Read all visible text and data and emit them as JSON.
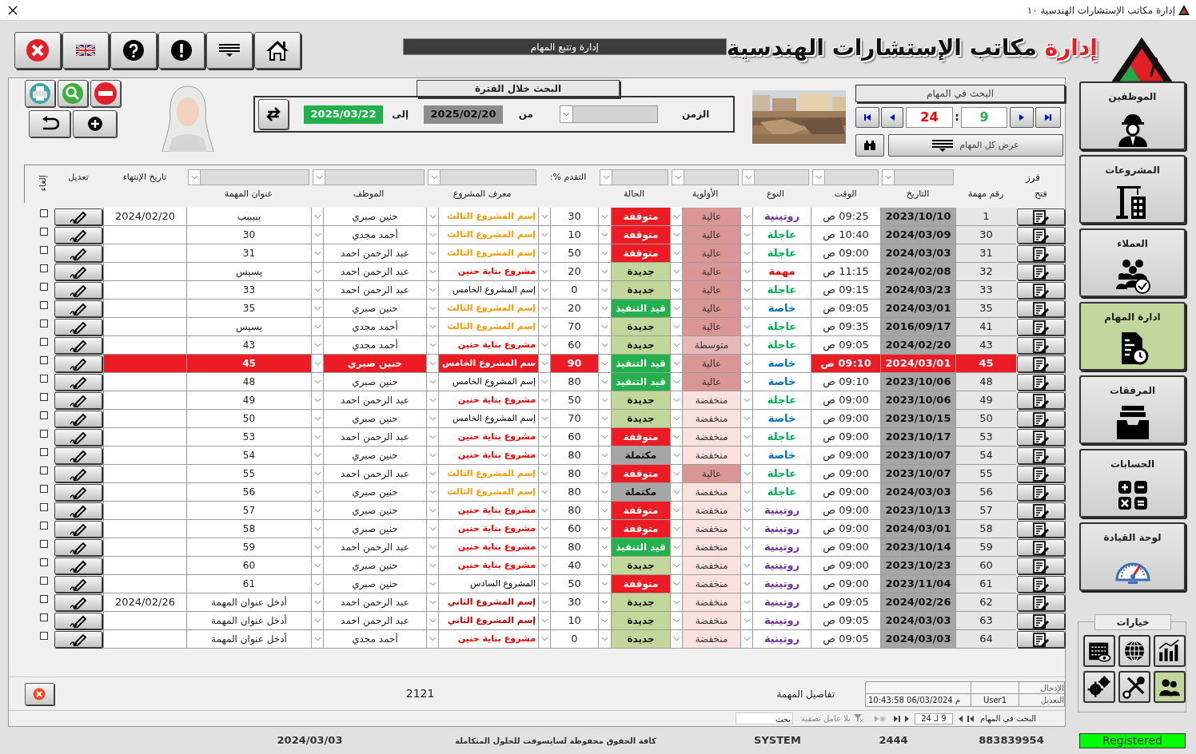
{
  "window": {
    "title": "إدارة مكاتب الإستشارات الهندسية ١٠"
  },
  "header": {
    "section_title": "إدارة وتتبع المهام",
    "logo_highlight": "إدارة",
    "logo_rest": "مكاتب الإستشارات الهندسية"
  },
  "period_search": {
    "title": "البحث خلال الفترة",
    "time_label": "الزمن",
    "from_label": "من",
    "from": "2025/02/20",
    "to_label": "إلى",
    "to": "2025/03/22"
  },
  "task_search": {
    "title": "البحث في المهام",
    "total": "24",
    "separator": ":",
    "current": "9",
    "show_all": "عرض كل المهام"
  },
  "table": {
    "sort_label": "فرز",
    "progress_filter_label": "التقدم %:",
    "end_date_label": "تاريخ الإنتهاء",
    "edit_label": "تعديل",
    "cancel_label": "إلغاء",
    "columns": [
      "فتح",
      "رقم مهمة",
      "التاريخ",
      "الوقت",
      "النوع",
      "الأولوية",
      "الحالة",
      "معرف المشروع",
      "الموظف",
      "عنوان المهمة"
    ],
    "rows": [
      {
        "number": "1",
        "date": "2023/10/10",
        "time": "09:25 ص",
        "type": {
          "text": "روتينية",
          "kind": "routine"
        },
        "priority": {
          "text": "عالية",
          "kind": "high"
        },
        "status": {
          "text": "متوقفة",
          "kind": "stopped"
        },
        "progress": "30",
        "project": {
          "text": "إسم المشروع الثالث",
          "color": "#ff9900",
          "bold": true
        },
        "employee": "حنين صبري",
        "title": "بببببب",
        "end_date": "2024/02/20",
        "checked": false,
        "selected": false
      },
      {
        "number": "30",
        "date": "2024/03/09",
        "time": "10:40 ص",
        "type": {
          "text": "عاجلة",
          "kind": "urgent"
        },
        "priority": {
          "text": "عالية",
          "kind": "high"
        },
        "status": {
          "text": "متوقفة",
          "kind": "stopped"
        },
        "progress": "10",
        "project": {
          "text": "إسم المشروع الثالث",
          "color": "#ff9900",
          "bold": true
        },
        "employee": "أحمد مجدي",
        "title": "30",
        "checked": false,
        "selected": false
      },
      {
        "number": "31",
        "date": "2024/03/03",
        "time": "09:00 ص",
        "type": {
          "text": "عاجلة",
          "kind": "urgent"
        },
        "priority": {
          "text": "عالية",
          "kind": "high"
        },
        "status": {
          "text": "متوقفة",
          "kind": "stopped"
        },
        "progress": "50",
        "project": {
          "text": "إسم المشروع الثالث",
          "color": "#ff9900",
          "bold": true
        },
        "employee": "عبد الرحمن احمد",
        "title": "31",
        "checked": false,
        "selected": false
      },
      {
        "number": "32",
        "date": "2024/02/08",
        "time": "11:15 ص",
        "type": {
          "text": "مهمة",
          "kind": "important"
        },
        "priority": {
          "text": "عالية",
          "kind": "high"
        },
        "status": {
          "text": "جديدة",
          "kind": "new"
        },
        "progress": "20",
        "project": {
          "text": "مشروع بناية حنين",
          "color": "#ff0000",
          "bold": true
        },
        "employee": "عبد الرحمن احمد",
        "title": "يسيس",
        "checked": false,
        "selected": false
      },
      {
        "number": "33",
        "date": "2024/03/23",
        "time": "09:15 ص",
        "type": {
          "text": "عاجلة",
          "kind": "urgent"
        },
        "priority": {
          "text": "عالية",
          "kind": "high"
        },
        "status": {
          "text": "جديدة",
          "kind": "new"
        },
        "progress": "0",
        "project": {
          "text": "إسم المشروع الخامس",
          "color": "#000000",
          "bold": false
        },
        "employee": "عبد الرحمن احمد",
        "title": "33",
        "checked": false,
        "selected": false
      },
      {
        "number": "35",
        "date": "2024/03/01",
        "time": "09:05 ص",
        "type": {
          "text": "خاصة",
          "kind": "special"
        },
        "priority": {
          "text": "عالية",
          "kind": "high"
        },
        "status": {
          "text": "قيد التنفيذ",
          "kind": "progress"
        },
        "progress": "20",
        "project": {
          "text": "إسم المشروع الثالث",
          "color": "#ff9900",
          "bold": true
        },
        "employee": "حنين صبري",
        "title": "35",
        "checked": false,
        "selected": false
      },
      {
        "number": "41",
        "date": "2016/09/17",
        "time": "09:35 ص",
        "type": {
          "text": "عاجلة",
          "kind": "urgent"
        },
        "priority": {
          "text": "عالية",
          "kind": "high"
        },
        "status": {
          "text": "جديدة",
          "kind": "new"
        },
        "progress": "70",
        "project": {
          "text": "إسم المشروع الثالث",
          "color": "#ff9900",
          "bold": true
        },
        "employee": "أحمد مجدي",
        "title": "يسيس",
        "checked": false,
        "selected": false
      },
      {
        "number": "43",
        "date": "2024/02/20",
        "time": "09:05 ص",
        "type": {
          "text": "عاجلة",
          "kind": "urgent"
        },
        "priority": {
          "text": "متوسطة",
          "kind": "medium"
        },
        "status": {
          "text": "جديدة",
          "kind": "new"
        },
        "progress": "60",
        "project": {
          "text": "مشروع بناية حنين",
          "color": "#ff0000",
          "bold": true
        },
        "employee": "أحمد مجدي",
        "title": "43",
        "checked": false,
        "selected": false
      },
      {
        "number": "45",
        "date": "2024/03/01",
        "time": "09:10 ص",
        "type": {
          "text": "خاصة",
          "kind": "special"
        },
        "priority": {
          "text": "عالية",
          "kind": "high"
        },
        "status": {
          "text": "قيد التنفيذ",
          "kind": "progress"
        },
        "progress": "90",
        "project": {
          "text": "سم المشروع الخامس"
        },
        "employee": "حنين صبري",
        "title": "45",
        "checked": false,
        "selected": true
      },
      {
        "number": "48",
        "date": "2023/10/06",
        "time": "09:10 ص",
        "type": {
          "text": "خاصة",
          "kind": "special"
        },
        "priority": {
          "text": "عالية",
          "kind": "high"
        },
        "status": {
          "text": "قيد التنفيذ",
          "kind": "progress"
        },
        "progress": "80",
        "project": {
          "text": "إسم المشروع الخامس",
          "color": "#000000",
          "bold": false
        },
        "employee": "حنين صبري",
        "title": "48",
        "checked": false,
        "selected": false
      },
      {
        "number": "49",
        "date": "2023/10/06",
        "time": "09:00 ص",
        "type": {
          "text": "عاجلة",
          "kind": "urgent"
        },
        "priority": {
          "text": "منخفضة",
          "kind": "low"
        },
        "status": {
          "text": "جديدة",
          "kind": "new"
        },
        "progress": "50",
        "project": {
          "text": "مشروع بناية حنين",
          "color": "#ff0000",
          "bold": true
        },
        "employee": "عبد الرحمن احمد",
        "title": "49",
        "checked": false,
        "selected": false
      },
      {
        "number": "50",
        "date": "2023/10/15",
        "time": "09:00 ص",
        "type": {
          "text": "خاصة",
          "kind": "special"
        },
        "priority": {
          "text": "منخفضة",
          "kind": "low"
        },
        "status": {
          "text": "جديدة",
          "kind": "new"
        },
        "progress": "70",
        "project": {
          "text": "إسم المشروع الخامس",
          "color": "#000000",
          "bold": false
        },
        "employee": "حنين صبري",
        "title": "50",
        "checked": false,
        "selected": false
      },
      {
        "number": "53",
        "date": "2023/10/17",
        "time": "09:00 ص",
        "type": {
          "text": "عاجلة",
          "kind": "urgent"
        },
        "priority": {
          "text": "منخفضة",
          "kind": "low"
        },
        "status": {
          "text": "متوقفة",
          "kind": "stopped"
        },
        "progress": "60",
        "project": {
          "text": "مشروع بناية حنين",
          "color": "#ff0000",
          "bold": true
        },
        "employee": "عبد الرحمن احمد",
        "title": "53",
        "checked": false,
        "selected": false
      },
      {
        "number": "54",
        "date": "2023/10/07",
        "time": "09:00 ص",
        "type": {
          "text": "خاصة",
          "kind": "special"
        },
        "priority": {
          "text": "منخفضة",
          "kind": "low"
        },
        "status": {
          "text": "مكتملة",
          "kind": "done"
        },
        "progress": "80",
        "project": {
          "text": "مشروع بناية حنين",
          "color": "#ff0000",
          "bold": true
        },
        "employee": "حنين صبري",
        "title": "54",
        "checked": false,
        "selected": false
      },
      {
        "number": "55",
        "date": "2023/10/07",
        "time": "09:00 ص",
        "type": {
          "text": "عاجلة",
          "kind": "urgent"
        },
        "priority": {
          "text": "عالية",
          "kind": "high"
        },
        "status": {
          "text": "متوقفة",
          "kind": "stopped"
        },
        "progress": "80",
        "project": {
          "text": "إسم المشروع الثالث",
          "color": "#ff9900",
          "bold": true
        },
        "employee": "عبد الرحمن احمد",
        "title": "55",
        "checked": false,
        "selected": false
      },
      {
        "number": "56",
        "date": "2024/03/03",
        "time": "09:00 ص",
        "type": {
          "text": "عاجلة",
          "kind": "urgent"
        },
        "priority": {
          "text": "منخفضة",
          "kind": "low"
        },
        "status": {
          "text": "مكتملة",
          "kind": "done"
        },
        "progress": "80",
        "project": {
          "text": "إسم المشروع الثالث",
          "color": "#ff9900",
          "bold": true
        },
        "employee": "حنين صبري",
        "title": "56",
        "checked": false,
        "selected": false
      },
      {
        "number": "57",
        "date": "2023/10/13",
        "time": "09:00 ص",
        "type": {
          "text": "روتينية",
          "kind": "routine"
        },
        "priority": {
          "text": "منخفضة",
          "kind": "low"
        },
        "status": {
          "text": "متوقفة",
          "kind": "stopped"
        },
        "progress": "80",
        "project": {
          "text": "مشروع بناية حنين",
          "color": "#ff0000",
          "bold": true
        },
        "employee": "حنين صبري",
        "title": "57",
        "checked": false,
        "selected": false
      },
      {
        "number": "58",
        "date": "2024/03/01",
        "time": "09:00 ص",
        "type": {
          "text": "روتينية",
          "kind": "routine"
        },
        "priority": {
          "text": "منخفضة",
          "kind": "low"
        },
        "status": {
          "text": "متوقفة",
          "kind": "stopped"
        },
        "progress": "60",
        "project": {
          "text": "مشروع بناية حنين",
          "color": "#ff0000",
          "bold": true
        },
        "employee": "حنين صبري",
        "title": "58",
        "checked": false,
        "selected": false
      },
      {
        "number": "59",
        "date": "2023/10/14",
        "time": "09:00 ص",
        "type": {
          "text": "روتينية",
          "kind": "routine"
        },
        "priority": {
          "text": "منخفضة",
          "kind": "low"
        },
        "status": {
          "text": "قيد التنفيذ",
          "kind": "progress"
        },
        "progress": "80",
        "project": {
          "text": "مشروع بناية حنين",
          "color": "#ff0000",
          "bold": true
        },
        "employee": "عبد الرحمن احمد",
        "title": "59",
        "checked": false,
        "selected": false
      },
      {
        "number": "60",
        "date": "2023/10/23",
        "time": "09:00 ص",
        "type": {
          "text": "روتينية",
          "kind": "routine"
        },
        "priority": {
          "text": "منخفضة",
          "kind": "low"
        },
        "status": {
          "text": "جديدة",
          "kind": "new"
        },
        "progress": "40",
        "project": {
          "text": "مشروع بناية حنين",
          "color": "#ff0000",
          "bold": true
        },
        "employee": "حنين صبري",
        "title": "60",
        "checked": false,
        "selected": false
      },
      {
        "number": "61",
        "date": "2023/11/04",
        "time": "09:00 ص",
        "type": {
          "text": "روتينية",
          "kind": "routine"
        },
        "priority": {
          "text": "منخفضة",
          "kind": "low"
        },
        "status": {
          "text": "متوقفة",
          "kind": "stopped"
        },
        "progress": "50",
        "project": {
          "text": "المشروع السادس",
          "color": "#000000",
          "bold": false
        },
        "employee": "حنين صبري",
        "title": "61",
        "checked": false,
        "selected": false
      },
      {
        "number": "62",
        "date": "2024/02/26",
        "time": "09:05 ص",
        "type": {
          "text": "روتينية",
          "kind": "routine"
        },
        "priority": {
          "text": "منخفضة",
          "kind": "low"
        },
        "status": {
          "text": "جديدة",
          "kind": "new"
        },
        "progress": "30",
        "project": {
          "text": "إسم المشروع الثاني",
          "color": "#c00000",
          "bold": true
        },
        "employee": "عبد الرحمن احمد",
        "title": "أدخل عنوان المهمة",
        "end_date": "2024/02/26",
        "checked": false,
        "selected": false
      },
      {
        "number": "63",
        "date": "2024/03/03",
        "time": "09:05 ص",
        "type": {
          "text": "روتينية",
          "kind": "routine"
        },
        "priority": {
          "text": "منخفضة",
          "kind": "low"
        },
        "status": {
          "text": "جديدة",
          "kind": "new"
        },
        "progress": "10",
        "project": {
          "text": "إسم المشروع الثاني",
          "color": "#c00000",
          "bold": true
        },
        "employee": "عبد الرحمن احمد",
        "title": "أدخل عنوان المهمة",
        "checked": false,
        "selected": false
      },
      {
        "number": "64",
        "date": "2024/03/03",
        "time": "09:05 ص",
        "type": {
          "text": "روتينية",
          "kind": "routine"
        },
        "priority": {
          "text": "منخفضة",
          "kind": "low"
        },
        "status": {
          "text": "جديدة",
          "kind": "new"
        },
        "progress": "0",
        "project": {
          "text": "مشروع بناية حنين",
          "color": "#ff0000",
          "bold": true
        },
        "employee": "أحمد مجدي",
        "title": "أدخل عنوان المهمة",
        "checked": false,
        "selected": false
      }
    ]
  },
  "details": {
    "value": "2121",
    "label": "تفاصيل المهمة",
    "entry_label": "الإدخال",
    "edit_label": "التعديل",
    "edit_user": "User1",
    "edit_time": "10:43:58 06/03/2024 م"
  },
  "record_nav": {
    "label": "البحث في المهام",
    "position": "9 لـ 24",
    "filter": "بلا عامل تصفية",
    "search": "بحث"
  },
  "sidebar": {
    "items": [
      {
        "label": "الموظفين",
        "selected": false
      },
      {
        "label": "المشروعات",
        "selected": false
      },
      {
        "label": "العملاء",
        "selected": false
      },
      {
        "label": "ادارة المهام",
        "selected": true
      },
      {
        "label": "المرفقات",
        "selected": false
      },
      {
        "label": "الحسابات",
        "selected": false
      },
      {
        "label": "لوحة القيادة",
        "selected": false
      }
    ],
    "options_title": "خيارات",
    "options": [
      {
        "selected": false
      },
      {
        "selected": false
      },
      {
        "selected": false
      },
      {
        "selected": true
      },
      {
        "selected": false
      },
      {
        "selected": false
      }
    ]
  },
  "status_bar": {
    "serial": "883839954",
    "code": "2444",
    "user": "SYSTEM",
    "copyright": "كافة الحقوق محفوظة لسايسوفت للحلول المتكاملة",
    "date": "2024/03/03",
    "registration": "Registered"
  }
}
